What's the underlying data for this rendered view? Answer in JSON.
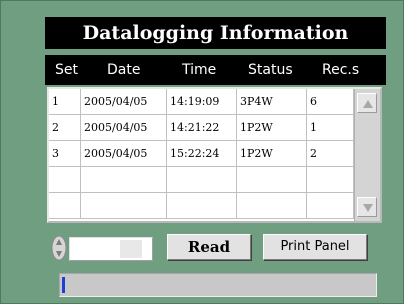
{
  "title": "Datalogging Information",
  "columns": [
    "Set",
    "Date",
    "Time",
    "Status",
    "Rec.s"
  ],
  "rows": [
    [
      "1",
      "2005/04/05",
      "14:19:09",
      "3P4W",
      "6"
    ],
    [
      "2",
      "2005/04/05",
      "14:21:22",
      "1P2W",
      "1"
    ],
    [
      "3",
      "2005/04/05",
      "15:22:24",
      "1P2W",
      "2"
    ],
    [
      "",
      "",
      "",
      "",
      ""
    ],
    [
      "",
      "",
      "",
      "",
      ""
    ]
  ],
  "numeric_input": {
    "value": ""
  },
  "buttons": {
    "read": "Read",
    "print_panel": "Print Panel"
  },
  "progress": {
    "fraction": 0.01,
    "fill_color": "#1e3fd0"
  },
  "icons": {
    "scroll_up": "arrow-up-icon",
    "scroll_down": "arrow-down-icon",
    "spinner": "spinner-arrows-icon"
  }
}
